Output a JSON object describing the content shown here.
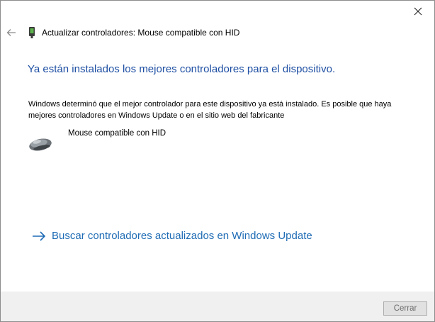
{
  "window": {
    "title": "Actualizar controladores: Mouse compatible con HID"
  },
  "main": {
    "heading": "Ya están instalados los mejores controladores para el dispositivo.",
    "description": "Windows determinó que el mejor controlador para este dispositivo ya está instalado. Es posible que haya mejores controladores en Windows Update o en el sitio web del fabricante",
    "device_name": "Mouse compatible con HID",
    "device_icon": "mouse-icon",
    "update_link": "Buscar controladores actualizados en Windows Update"
  },
  "footer": {
    "close_label": "Cerrar"
  },
  "colors": {
    "heading": "#1e4fa3",
    "link": "#1f6cb5",
    "footer_bg": "#f0f0f0"
  }
}
